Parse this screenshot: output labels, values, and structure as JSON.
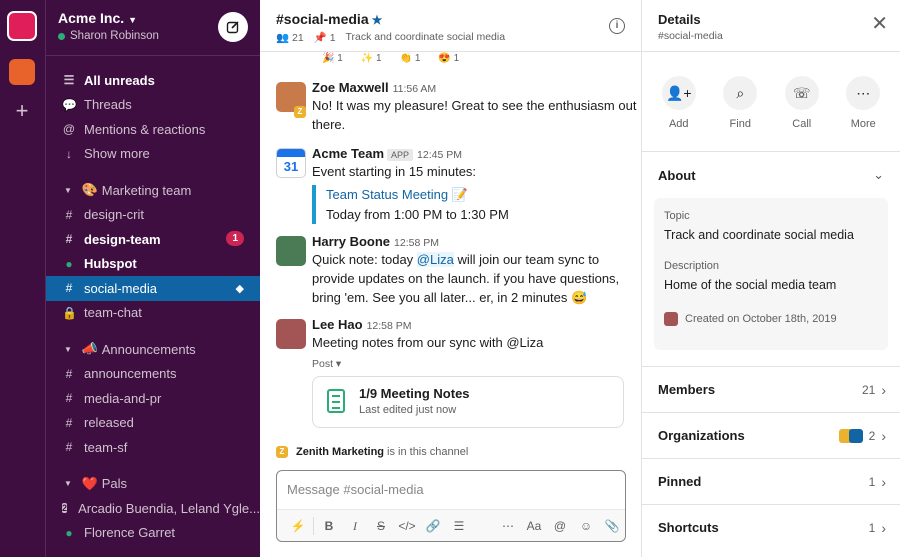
{
  "workspace": {
    "name": "Acme Inc.",
    "user": "Sharon Robinson"
  },
  "sidebar": {
    "top": [
      {
        "label": "All unreads",
        "icon": "list-icon"
      },
      {
        "label": "Threads",
        "icon": "threads-icon"
      },
      {
        "label": "Mentions & reactions",
        "icon": "at-icon"
      },
      {
        "label": "Show more",
        "icon": "arrow-down-icon"
      }
    ],
    "sections": [
      {
        "title": "Marketing team",
        "emoji": "🎨",
        "items": [
          {
            "label": "design-crit"
          },
          {
            "label": "design-team",
            "badge": "1"
          },
          {
            "label": "Hubspot"
          },
          {
            "label": "social-media"
          },
          {
            "label": "team-chat"
          }
        ]
      },
      {
        "title": "Announcements",
        "emoji": "📣",
        "items": [
          {
            "label": "announcements"
          },
          {
            "label": "media-and-pr"
          },
          {
            "label": "released"
          },
          {
            "label": "team-sf"
          }
        ]
      },
      {
        "title": "Pals",
        "emoji": "❤️",
        "items": [
          {
            "label": "Arcadio Buendia, Leland Ygle..."
          },
          {
            "label": "Florence Garret"
          }
        ]
      }
    ]
  },
  "channel": {
    "name": "#social-media",
    "members": "21",
    "pins": "1",
    "topic": "Track and coordinate social media",
    "reactions": [
      "🎉 1",
      "✨ 1",
      "👏 1",
      "😍 1"
    ]
  },
  "messages": [
    {
      "author": "Zoe Maxwell",
      "time": "11:56 AM",
      "text": "No! It was my pleasure! Great to see the enthusiasm out there."
    },
    {
      "author": "Acme Team",
      "tag": "APP",
      "time": "12:45 PM",
      "text": "Event starting in 15 minutes:",
      "cal_day": "31",
      "event_title": "Team Status Meeting 📝",
      "event_time": "Today from 1:00 PM to 1:30 PM"
    },
    {
      "author": "Harry Boone",
      "time": "12:58 PM",
      "text_before": "Quick note: today ",
      "mention": "@Liza",
      "text_after": " will join our team sync to provide updates on the launch. if you have questions, bring 'em. See you all later... er, in 2 minutes 😅"
    },
    {
      "author": "Lee Hao",
      "time": "12:58 PM",
      "text": "Meeting notes from our sync with @Liza",
      "post_label": "Post ▾",
      "post_title": "1/9 Meeting Notes",
      "post_sub": "Last edited just now"
    }
  ],
  "in_channel": {
    "name": "Zenith Marketing",
    "text": "is in this channel"
  },
  "composer": {
    "placeholder": "Message #social-media"
  },
  "details": {
    "title": "Details",
    "subtitle": "#social-media",
    "actions": [
      "Add",
      "Find",
      "Call",
      "More"
    ],
    "about_title": "About",
    "topic_label": "Topic",
    "topic": "Track and coordinate social media",
    "description_label": "Description",
    "description": "Home of the social media team",
    "created": "Created on October 18th, 2019",
    "rows": [
      {
        "label": "Members",
        "value": "21"
      },
      {
        "label": "Organizations",
        "value": "2"
      },
      {
        "label": "Pinned",
        "value": "1"
      },
      {
        "label": "Shortcuts",
        "value": "1"
      }
    ]
  },
  "colors": {
    "sidebar": "#3f0e40",
    "active": "#1164a3",
    "badge": "#cd2553",
    "link": "#1264a3"
  }
}
